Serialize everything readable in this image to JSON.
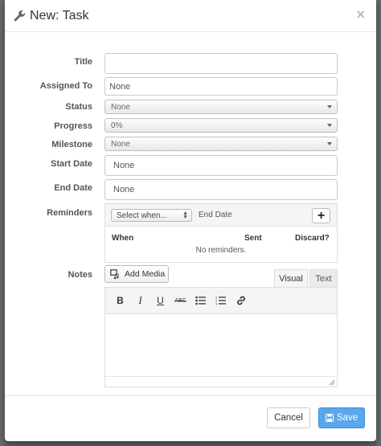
{
  "dialog": {
    "title": "New: Task",
    "close_label": "×"
  },
  "form": {
    "title": {
      "label": "Title",
      "value": ""
    },
    "assigned_to": {
      "label": "Assigned To",
      "value": "None"
    },
    "status": {
      "label": "Status",
      "value": "None"
    },
    "progress": {
      "label": "Progress",
      "value": "0%"
    },
    "milestone": {
      "label": "Milestone",
      "value": "None"
    },
    "start_date": {
      "label": "Start Date",
      "value": "None"
    },
    "end_date": {
      "label": "End Date",
      "value": "None"
    }
  },
  "reminders": {
    "label": "Reminders",
    "select_value": "Select when...",
    "date_label": "End Date",
    "add_label": "+",
    "columns": [
      "When",
      "Sent",
      "Discard?"
    ],
    "empty_text": "No reminders."
  },
  "notes": {
    "label": "Notes",
    "add_media_label": "Add Media",
    "tabs": [
      "Visual",
      "Text"
    ],
    "toolbar": {
      "bold": "B",
      "italic": "I",
      "underline": "U",
      "strike": "ABC"
    }
  },
  "footer": {
    "cancel_label": "Cancel",
    "save_label": "Save"
  },
  "colors": {
    "primary": "#5aa7eb",
    "border": "#c9c9c9",
    "label": "#555555"
  },
  "icons": [
    "wrench-icon",
    "close-icon",
    "media-icon",
    "bullet-list-icon",
    "numbered-list-icon",
    "link-icon",
    "resize-grip-icon",
    "save-icon"
  ]
}
